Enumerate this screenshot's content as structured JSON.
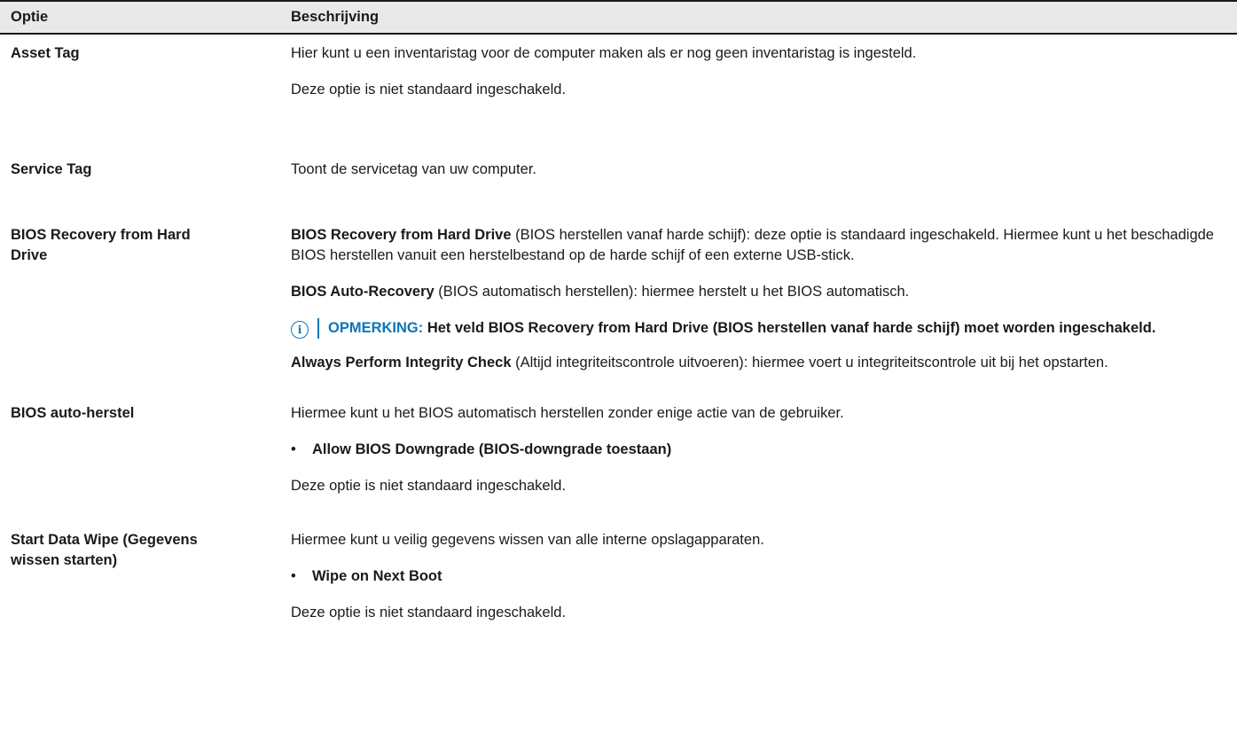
{
  "header": {
    "col1": "Optie",
    "col2": "Beschrijving"
  },
  "rows": [
    {
      "option": "Asset Tag",
      "p1": "Hier kunt u een inventaristag voor de computer maken als er nog geen inventaristag is ingesteld.",
      "p2": "Deze optie is niet standaard ingeschakeld."
    },
    {
      "option": "Service Tag",
      "p1": "Toont de servicetag van uw computer."
    },
    {
      "option_line1": "BIOS Recovery from Hard",
      "option_line2": "Drive",
      "p1_bold": "BIOS Recovery from Hard Drive",
      "p1_rest": " (BIOS herstellen vanaf harde schijf): deze optie is standaard ingeschakeld. Hiermee kunt u het beschadigde BIOS herstellen vanuit een herstelbestand op de harde schijf of een externe USB-stick.",
      "p2_bold": "BIOS Auto-Recovery",
      "p2_rest": " (BIOS automatisch herstellen): hiermee herstelt u het BIOS automatisch.",
      "note_label": "OPMERKING:",
      "note_text": " Het veld BIOS Recovery from Hard Drive (BIOS herstellen vanaf harde schijf) moet worden ingeschakeld.",
      "p3_bold": "Always Perform Integrity Check",
      "p3_rest": " (Altijd integriteitscontrole uitvoeren): hiermee voert u integriteitscontrole uit bij het opstarten."
    },
    {
      "option": "BIOS auto-herstel",
      "p1": "Hiermee kunt u het BIOS automatisch herstellen zonder enige actie van de gebruiker.",
      "bullet": "Allow BIOS Downgrade (BIOS-downgrade toestaan)",
      "p2": "Deze optie is niet standaard ingeschakeld."
    },
    {
      "option_line1": "Start Data Wipe (Gegevens",
      "option_line2": "wissen starten)",
      "p1": "Hiermee kunt u veilig gegevens wissen van alle interne opslagapparaten.",
      "bullet": "Wipe on Next Boot",
      "p2": "Deze optie is niet standaard ingeschakeld."
    }
  ],
  "icons": {
    "note": "info-icon"
  },
  "colors": {
    "note_accent": "#0a77b8",
    "header_bg": "#e9e9e9"
  }
}
